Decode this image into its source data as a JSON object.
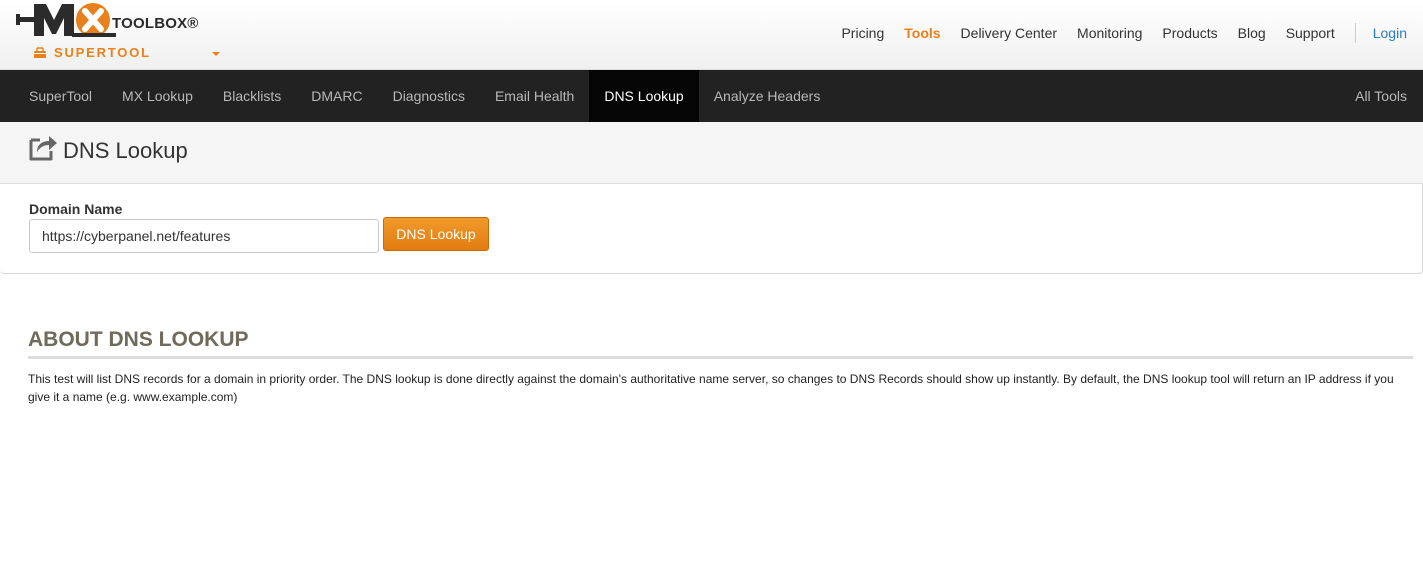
{
  "logo": {
    "mark": "MX",
    "toolbox": "TOOLBOX®",
    "supertool": "SUPERTOOL"
  },
  "topnav": {
    "items": [
      {
        "label": "Pricing",
        "active": false
      },
      {
        "label": "Tools",
        "active": true
      },
      {
        "label": "Delivery Center",
        "active": false
      },
      {
        "label": "Monitoring",
        "active": false
      },
      {
        "label": "Products",
        "active": false
      },
      {
        "label": "Blog",
        "active": false
      },
      {
        "label": "Support",
        "active": false
      }
    ],
    "login": "Login"
  },
  "toolbar": {
    "tabs": [
      {
        "label": "SuperTool"
      },
      {
        "label": "MX Lookup"
      },
      {
        "label": "Blacklists"
      },
      {
        "label": "DMARC"
      },
      {
        "label": "Diagnostics"
      },
      {
        "label": "Email Health"
      },
      {
        "label": "DNS Lookup",
        "active": true
      },
      {
        "label": "Analyze Headers"
      }
    ],
    "all_tools": "All Tools"
  },
  "page": {
    "title": "DNS Lookup",
    "title_icon": "share-box-icon"
  },
  "form": {
    "label": "Domain Name",
    "value": "https://cyberpanel.net/features",
    "button": "DNS Lookup"
  },
  "about": {
    "heading": "ABOUT DNS LOOKUP",
    "text": "This test will list DNS records for a domain in priority order. The DNS lookup is done directly against the domain's authoritative name server, so changes to DNS Records should show up instantly. By default, the DNS lookup tool will return an IP address if you give it a name (e.g. www.example.com)"
  },
  "colors": {
    "accent": "#e8801b",
    "link": "#2a7bc0",
    "toolbar_bg": "#222222",
    "toolbar_active": "#050505",
    "heading": "#6f6a5a"
  }
}
